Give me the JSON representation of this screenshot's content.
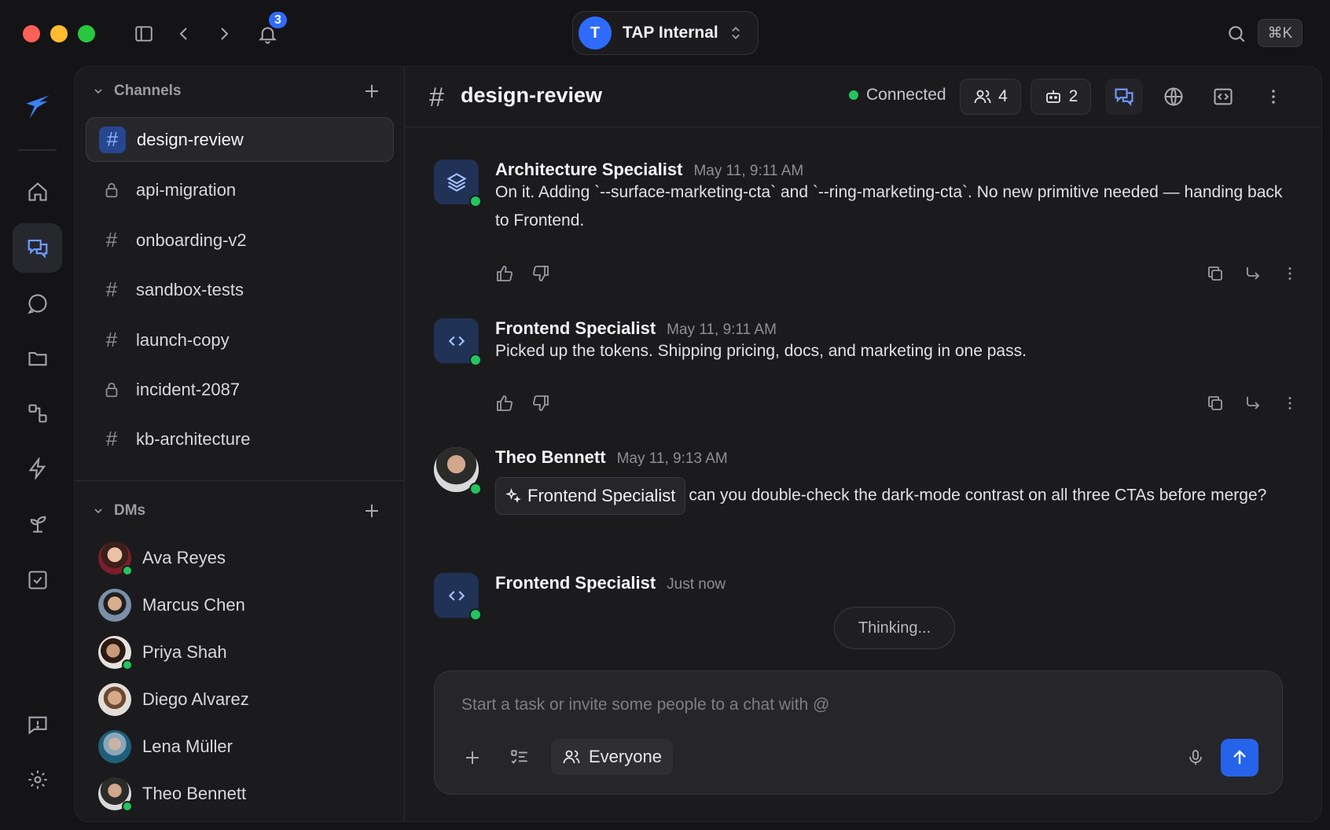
{
  "titlebar": {
    "notification_count": "3",
    "workspace_initial": "T",
    "workspace_name": "TAP Internal",
    "shortcut": "⌘K"
  },
  "rail": {
    "items": [
      "logo",
      "home-icon",
      "chats-icon",
      "message-icon",
      "folder-icon",
      "workflow-icon",
      "bolt-icon",
      "sprout-icon",
      "checkbox-icon",
      "feedback-icon",
      "gear-icon"
    ],
    "active": "chats-icon"
  },
  "sidebar": {
    "channels_label": "Channels",
    "channels": [
      {
        "name": "design-review",
        "type": "public",
        "active": true
      },
      {
        "name": "api-migration",
        "type": "private"
      },
      {
        "name": "onboarding-v2",
        "type": "public"
      },
      {
        "name": "sandbox-tests",
        "type": "public"
      },
      {
        "name": "launch-copy",
        "type": "public"
      },
      {
        "name": "incident-2087",
        "type": "private"
      },
      {
        "name": "kb-architecture",
        "type": "public"
      }
    ],
    "dms_label": "DMs",
    "dms": [
      {
        "name": "Ava Reyes",
        "online": true
      },
      {
        "name": "Marcus Chen",
        "online": false
      },
      {
        "name": "Priya Shah",
        "online": true
      },
      {
        "name": "Diego Alvarez",
        "online": false
      },
      {
        "name": "Lena Müller",
        "online": false
      },
      {
        "name": "Theo Bennett",
        "online": true
      }
    ]
  },
  "chat": {
    "channel": "design-review",
    "status": "Connected",
    "members_count": "4",
    "agents_count": "2",
    "messages": [
      {
        "author": "Architecture Specialist",
        "time": "May 11, 9:11 AM",
        "avatar": "layers-icon",
        "text": "On it. Adding `--surface-marketing-cta` and `--ring-marketing-cta`. No new primitive needed — handing back to Frontend."
      },
      {
        "author": "Frontend Specialist",
        "time": "May 11, 9:11 AM",
        "avatar": "code-icon",
        "text": "Picked up the tokens. Shipping pricing, docs, and marketing in one pass."
      },
      {
        "author": "Theo Bennett",
        "time": "May 11, 9:13 AM",
        "avatar": "photo",
        "mention": "Frontend Specialist",
        "text": "can you double-check the dark-mode contrast on all three CTAs before merge?"
      },
      {
        "author": "Frontend Specialist",
        "time": "Just now",
        "avatar": "code-icon",
        "status": "Thinking..."
      }
    ]
  },
  "composer": {
    "placeholder": "Start a task or invite some people to a chat with @",
    "audience": "Everyone"
  },
  "colors": {
    "accent": "#2563eb",
    "online": "#22c55e",
    "background": "#1b1b1e"
  }
}
